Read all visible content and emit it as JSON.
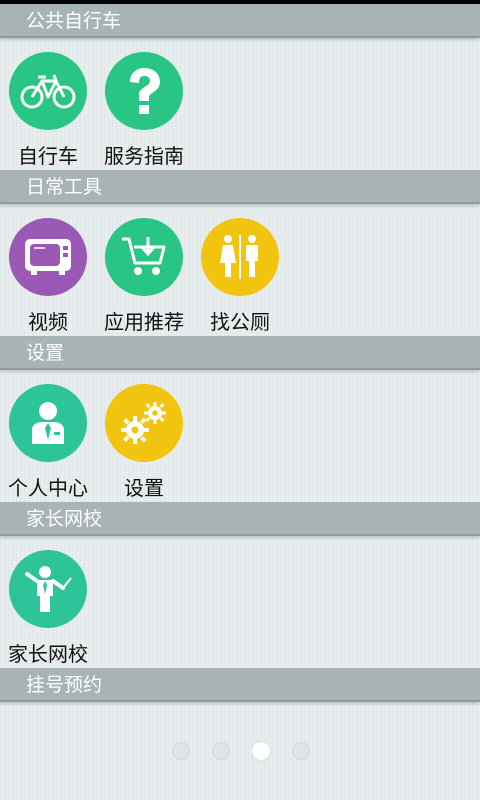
{
  "sections": [
    {
      "title": "公共自行车",
      "items": [
        {
          "label": "自行车",
          "icon": "bicycle-icon",
          "color": "#29c584"
        },
        {
          "label": "服务指南",
          "icon": "question-icon",
          "color": "#29c584"
        }
      ]
    },
    {
      "title": "日常工具",
      "items": [
        {
          "label": "视频",
          "icon": "tv-icon",
          "color": "#9b59b6"
        },
        {
          "label": "应用推荐",
          "icon": "cart-download-icon",
          "color": "#29c584"
        },
        {
          "label": "找公厕",
          "icon": "restroom-icon",
          "color": "#f1c40f"
        }
      ]
    },
    {
      "title": "设置",
      "items": [
        {
          "label": "个人中心",
          "icon": "user-icon",
          "color": "#2ec49a"
        },
        {
          "label": "设置",
          "icon": "gears-icon",
          "color": "#f1c40f"
        }
      ]
    },
    {
      "title": "家长网校",
      "items": [
        {
          "label": "家长网校",
          "icon": "teacher-icon",
          "color": "#2ec49a"
        }
      ]
    },
    {
      "title": "挂号预约",
      "items": []
    }
  ],
  "pager": {
    "count": 4,
    "active_index": 2
  }
}
